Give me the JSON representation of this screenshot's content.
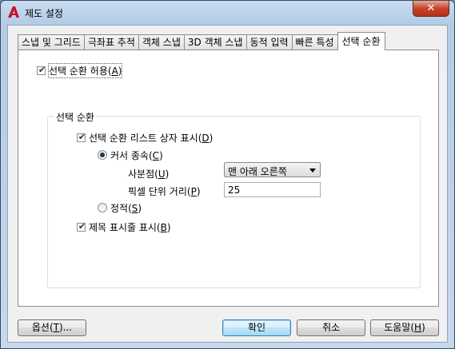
{
  "window": {
    "title": "제도 설정",
    "close_glyph": "✕"
  },
  "tabs": [
    {
      "label": "스냅 및 그리드",
      "active": false
    },
    {
      "label": "극좌표 추적",
      "active": false
    },
    {
      "label": "객체 스냅",
      "active": false
    },
    {
      "label": "3D 객체 스냅",
      "active": false
    },
    {
      "label": "동적 입력",
      "active": false
    },
    {
      "label": "빠른 특성",
      "active": false
    },
    {
      "label": "선택 순환",
      "active": true
    }
  ],
  "panel": {
    "allow_cycling": {
      "label_pre": "선택 순환 허용(",
      "mnemonic": "A",
      "label_post": ")",
      "checked": true
    },
    "group_title": "선택 순환",
    "show_list_box": {
      "label_pre": "선택 순환 리스트 상자 표시(",
      "mnemonic": "D",
      "label_post": ")",
      "checked": true
    },
    "cursor_dependent": {
      "label_pre": "커서 종속(",
      "mnemonic": "C",
      "label_post": ")",
      "selected": true
    },
    "quadrant": {
      "label_pre": "사분점(",
      "mnemonic": "U",
      "label_post": ")",
      "value": "맨 아래 오른쪽"
    },
    "pixel_distance": {
      "label_pre": "픽셀 단위 거리(",
      "mnemonic": "P",
      "label_post": ")",
      "value": "25"
    },
    "static": {
      "label_pre": "정적(",
      "mnemonic": "S",
      "label_post": ")",
      "selected": false
    },
    "show_title_bar": {
      "label_pre": "제목 표시줄 표시(",
      "mnemonic": "B",
      "label_post": ")",
      "checked": true
    }
  },
  "buttons": {
    "options": {
      "pre": "옵션(",
      "mn": "T",
      "post": ")..."
    },
    "ok": {
      "label": "확인"
    },
    "cancel": {
      "label": "취소"
    },
    "help": {
      "pre": "도움말(",
      "mn": "H",
      "post": ")"
    }
  }
}
